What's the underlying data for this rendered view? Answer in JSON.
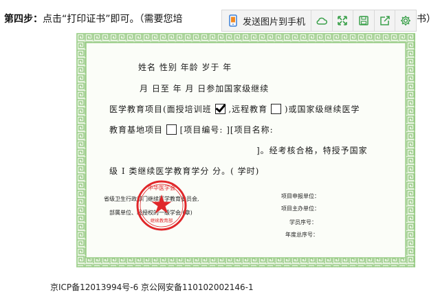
{
  "instruction": {
    "step_label": "第四步：",
    "text": "点击“打印证书”即可。（需要您培",
    "tail": "书）"
  },
  "toolbar": {
    "send_label": "发送图片到手机",
    "icons": [
      "phone-icon",
      "cloud-icon",
      "fullscreen-icon",
      "save-icon",
      "share-icon",
      "settings-icon"
    ],
    "accent": "#3aa04a"
  },
  "certificate": {
    "border_color": "#9ccf8a",
    "line1": "姓名            性别           年龄          岁于          年",
    "line2": "月      日至          年       月       日参加国家级继续",
    "line3a": "医学教育项目(面授培训班",
    "line3b": ",远程教育",
    "line3c": ")或国家级继续医学",
    "line4a": "教育基地项目",
    "line4b": "[项目编号:                     ][项目名称:",
    "line5": "]。经考核合格，特授予国家",
    "line6": "级 I 类继续医学教育学分        分。(        学时)",
    "check_face_to_face": true,
    "check_remote": false,
    "check_base": false,
    "issuer_line1": "省级卫生行政部门继续医学教育委员会,",
    "issuer_line2": "部属单位、经授权的一级学会 (章)",
    "right_labels": [
      "项目申报单位：",
      "项目主办单位：",
      "学员序号：",
      "年度总序号："
    ],
    "stamp_text": "中华医学会",
    "stamp_sub": "继续教育部",
    "stamp_color": "#e0272a"
  },
  "footer": {
    "text": "京ICP备12013994号-6 京公网安备110102002146-1"
  }
}
